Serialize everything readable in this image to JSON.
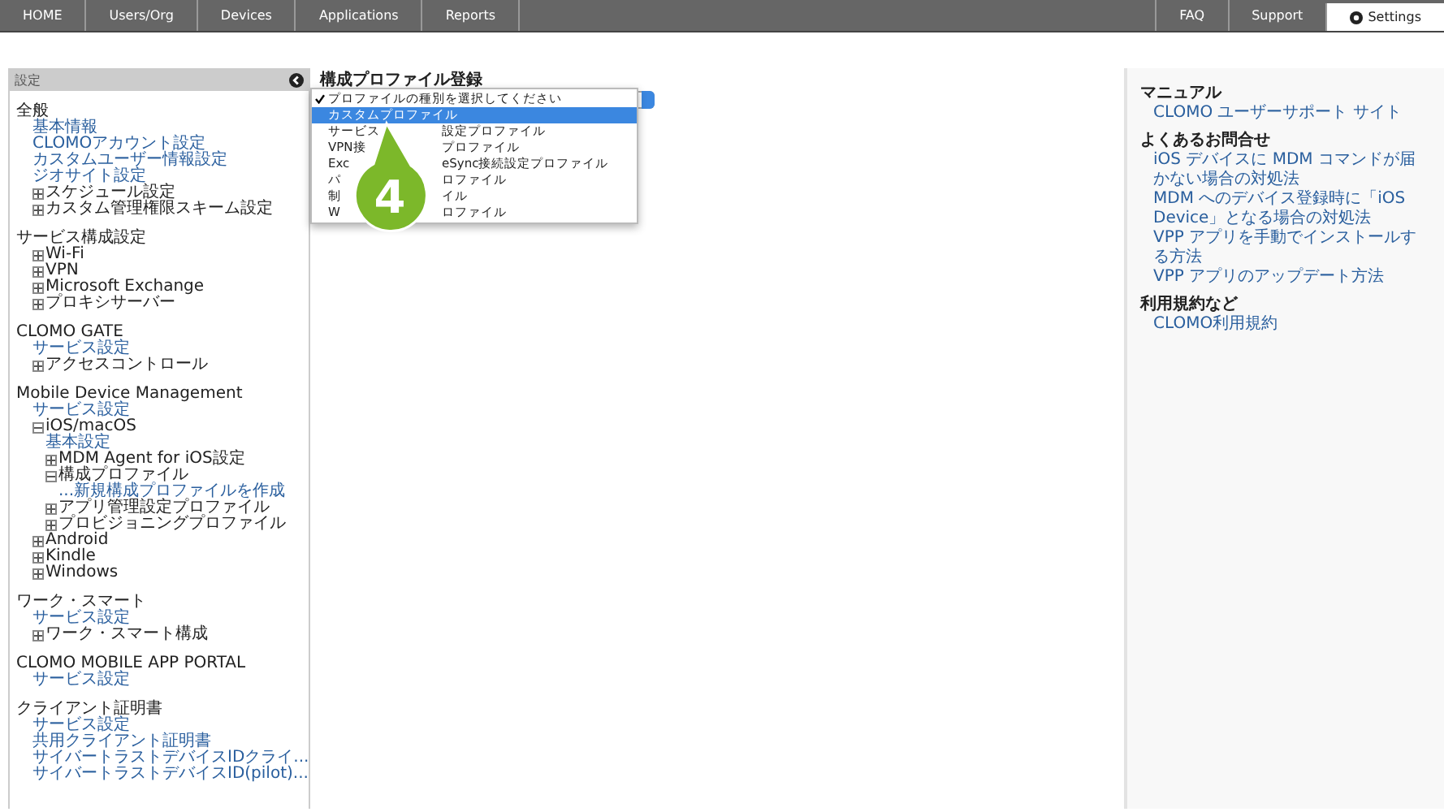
{
  "nav": {
    "left": [
      {
        "label": "HOME",
        "selected": false
      },
      {
        "label": "Users/Org",
        "selected": false
      },
      {
        "label": "Devices",
        "selected": false
      },
      {
        "label": "Applications",
        "selected": false
      },
      {
        "label": "Reports",
        "selected": false
      }
    ],
    "right": [
      {
        "label": "FAQ",
        "selected": false
      },
      {
        "label": "Support",
        "selected": false
      },
      {
        "label": "Settings",
        "selected": true
      }
    ]
  },
  "sidebar": {
    "title": "設定",
    "sections": [
      {
        "title": "全般",
        "items": [
          {
            "label": "基本情報"
          },
          {
            "label": "CLOMOアカウント設定"
          },
          {
            "label": "カスタムユーザー情報設定"
          },
          {
            "label": "ジオサイト設定"
          },
          {
            "label": "スケジュール設定",
            "expanded": false
          },
          {
            "label": "カスタム管理権限スキーム設定",
            "expanded": false
          }
        ]
      },
      {
        "title": "サービス構成設定",
        "items": [
          {
            "label": "Wi-Fi",
            "expanded": false
          },
          {
            "label": "VPN",
            "expanded": false
          },
          {
            "label": "Microsoft Exchange",
            "expanded": false
          },
          {
            "label": "プロキシサーバー",
            "expanded": false
          }
        ]
      },
      {
        "title": "CLOMO GATE",
        "items": [
          {
            "label": "サービス設定"
          },
          {
            "label": "アクセスコントロール",
            "expanded": false
          }
        ]
      },
      {
        "title": "Mobile Device Management",
        "items": [
          {
            "label": "サービス設定"
          },
          {
            "label": "iOS/macOS",
            "expanded": true,
            "children": [
              {
                "label": "基本設定"
              },
              {
                "label": "MDM Agent for iOS設定",
                "expanded": false
              },
              {
                "label": "構成プロファイル",
                "expanded": true,
                "children": [
                  {
                    "label": "...新規構成プロファイルを作成"
                  }
                ]
              },
              {
                "label": "アプリ管理設定プロファイル",
                "expanded": false
              },
              {
                "label": "プロビジョニングプロファイル",
                "expanded": false
              }
            ]
          },
          {
            "label": "Android",
            "expanded": false
          },
          {
            "label": "Kindle",
            "expanded": false
          },
          {
            "label": "Windows",
            "expanded": false
          }
        ]
      },
      {
        "title": "ワーク・スマート",
        "items": [
          {
            "label": "サービス設定"
          },
          {
            "label": "ワーク・スマート構成",
            "expanded": false
          }
        ]
      },
      {
        "title": "CLOMO MOBILE APP PORTAL",
        "items": [
          {
            "label": "サービス設定"
          }
        ]
      },
      {
        "title": "クライアント証明書",
        "items": [
          {
            "label": "サービス設定"
          },
          {
            "label": "共用クライアント証明書"
          },
          {
            "label": "サイバートラストデバイスIDクライ..."
          },
          {
            "label": "サイバートラストデバイスID(pilot)..."
          }
        ]
      }
    ]
  },
  "main": {
    "title": "構成プロファイル登録",
    "dropdown": [
      {
        "left": "プロファイルの種別を選択してください",
        "checked": true,
        "selected": false
      },
      {
        "left": "カスタムプロファイル",
        "checked": false,
        "selected": true
      },
      {
        "left": "サービス",
        "right": "設定プロファイル",
        "checked": false,
        "selected": false
      },
      {
        "left": "VPN接",
        "right": "プロファイル",
        "checked": false,
        "selected": false
      },
      {
        "left": "Exc",
        "right": "eSync接続設定プロファイル",
        "checked": false,
        "selected": false
      },
      {
        "left": "パ",
        "right": "ロファイル",
        "checked": false,
        "selected": false
      },
      {
        "left": "制",
        "right": "イル",
        "checked": false,
        "selected": false
      },
      {
        "left": "W",
        "right": "ロファイル",
        "checked": false,
        "selected": false
      }
    ],
    "callout": "4"
  },
  "help": [
    {
      "title": "マニュアル",
      "links": [
        "CLOMO ユーザーサポート サイト"
      ]
    },
    {
      "title": "よくあるお問合せ",
      "links": [
        "iOS デバイスに MDM コマンドが届かない場合の対処法",
        "MDM へのデバイス登録時に「iOS Device」となる場合の対処法",
        "VPP アプリを手動でインストールする方法",
        "VPP アプリのアップデート方法"
      ]
    },
    {
      "title": "利用規約など",
      "links": [
        "CLOMO利用規約"
      ]
    }
  ]
}
